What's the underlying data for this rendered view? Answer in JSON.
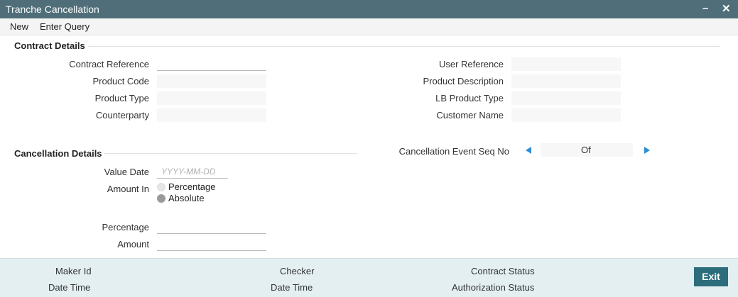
{
  "window": {
    "title": "Tranche Cancellation",
    "minimize_glyph": "–",
    "close_glyph": "✕"
  },
  "menu": {
    "new_label": "New",
    "enter_query_label": "Enter Query"
  },
  "contract_details": {
    "heading": "Contract Details",
    "contract_reference_label": "Contract Reference",
    "product_code_label": "Product Code",
    "product_type_label": "Product Type",
    "counterparty_label": "Counterparty",
    "user_reference_label": "User Reference",
    "product_description_label": "Product Description",
    "lb_product_type_label": "LB Product Type",
    "customer_name_label": "Customer Name"
  },
  "cancellation_details": {
    "heading": "Cancellation Details",
    "value_date_label": "Value Date",
    "value_date_placeholder": "YYYY-MM-DD",
    "amount_in_label": "Amount In",
    "option_percentage": "Percentage",
    "option_absolute": "Absolute",
    "selected_option": "Absolute",
    "percentage_label": "Percentage",
    "amount_label": "Amount",
    "event_seq_label": "Cancellation Event Seq No",
    "of_label": "Of"
  },
  "footer": {
    "maker_id_label": "Maker Id",
    "maker_date_time_label": "Date Time",
    "checker_label": "Checker",
    "checker_date_time_label": "Date Time",
    "contract_status_label": "Contract Status",
    "authorization_status_label": "Authorization Status",
    "exit_label": "Exit"
  },
  "colors": {
    "titlebar": "#4f6e79",
    "footer": "#e3eff1",
    "accent_arrow": "#2b8fd6",
    "exit_button": "#2c6d7c"
  },
  "icons": {
    "prev": "triangle-left-icon",
    "next": "triangle-right-icon",
    "close": "close-icon",
    "minimize": "minimize-icon"
  }
}
